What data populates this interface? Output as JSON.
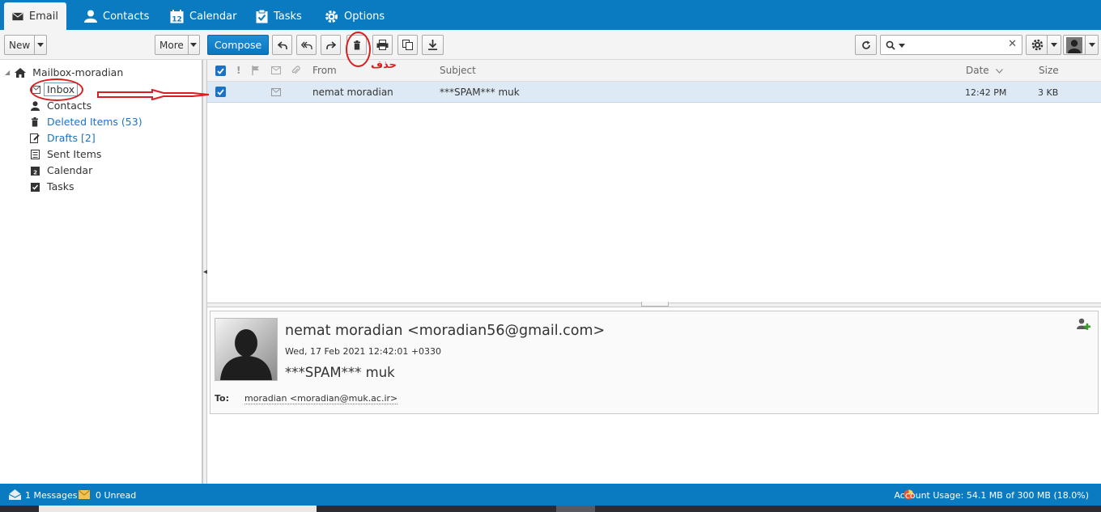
{
  "nav": {
    "tabs": [
      {
        "label": "Email",
        "icon": "envelope-icon",
        "active": true
      },
      {
        "label": "Contacts",
        "icon": "person-icon"
      },
      {
        "label": "Calendar",
        "icon": "calendar-icon"
      },
      {
        "label": "Tasks",
        "icon": "clipboard-check-icon"
      },
      {
        "label": "Options",
        "icon": "gear-icon"
      }
    ]
  },
  "toolbar": {
    "new_label": "New",
    "more_label": "More",
    "compose_label": "Compose",
    "search_placeholder": "",
    "search_value": ""
  },
  "sidebar": {
    "root_label": "Mailbox-moradian",
    "items": [
      {
        "label": "Inbox",
        "icon": "inbox-icon"
      },
      {
        "label": "Contacts",
        "icon": "person-icon"
      },
      {
        "label": "Deleted Items (53)",
        "icon": "trash-icon"
      },
      {
        "label": "Drafts [2]",
        "icon": "draft-icon"
      },
      {
        "label": "Sent Items",
        "icon": "sent-icon"
      },
      {
        "label": "Calendar",
        "icon": "calendar-icon"
      },
      {
        "label": "Tasks",
        "icon": "tasks-icon"
      }
    ]
  },
  "list": {
    "columns": {
      "from": "From",
      "subject": "Subject",
      "date": "Date",
      "size": "Size"
    },
    "rows": [
      {
        "from": "nemat moradian",
        "subject": "***SPAM*** muk",
        "date": "12:42 PM",
        "size": "3 KB",
        "selected": true
      }
    ]
  },
  "reading": {
    "from": "nemat moradian <moradian56@gmail.com>",
    "date": "Wed, 17 Feb 2021 12:42:01 +0330",
    "subject": "***SPAM*** muk",
    "to_label": "To:",
    "to_value": "moradian <moradian@muk.ac.ir>"
  },
  "status": {
    "messages": "1 Messages",
    "unread": "0 Unread",
    "usage": "Account Usage: 54.1 MB of 300 MB (18.0%)"
  },
  "annotation": {
    "delete_label": "حذف"
  },
  "colors": {
    "brand": "#0a7bc1",
    "selected_row": "#dde9f5",
    "link": "#1a73c4",
    "annotation": "#d81e1e"
  }
}
